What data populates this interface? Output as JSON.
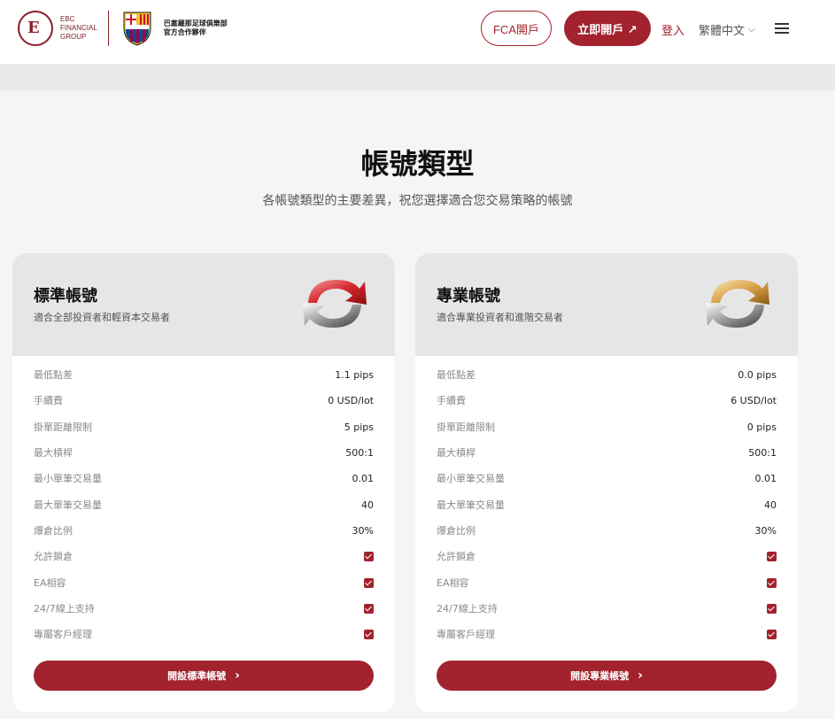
{
  "header": {
    "brand_line1": "EBC",
    "brand_line2": "FINANCIAL",
    "brand_line3": "GROUP",
    "partner_line1": "巴塞羅那足球俱樂部",
    "partner_line2": "官方合作夥伴",
    "fca_label": "FCA開戶",
    "open_label": "立即開戶 ↗",
    "login_label": "登入",
    "language_label": "繁體中文"
  },
  "main": {
    "title": "帳號類型",
    "subtitle": "各帳號類型的主要差異，祝您選擇適合您交易策略的帳號"
  },
  "cards": [
    {
      "title": "標準帳號",
      "desc": "適合全部投資者和輕資本交易者",
      "icon": "refresh-red-icon",
      "rows": [
        {
          "label": "最低點差",
          "value": "1.1 pips"
        },
        {
          "label": "手續費",
          "value": "0 USD/lot"
        },
        {
          "label": "掛單距離限制",
          "value": "5 pips"
        },
        {
          "label": "最大槓桿",
          "value": "500:1"
        },
        {
          "label": "最小單筆交易量",
          "value": "0.01"
        },
        {
          "label": "最大單筆交易量",
          "value": "40"
        },
        {
          "label": "爆倉比例",
          "value": "30%"
        },
        {
          "label": "允許鎖倉",
          "check": true
        },
        {
          "label": "EA相容",
          "check": true
        },
        {
          "label": "24/7線上支持",
          "check": true
        },
        {
          "label": "專屬客戶經理",
          "check": true
        }
      ],
      "button": "開設標準帳號"
    },
    {
      "title": "專業帳號",
      "desc": "適合專業投資者和進階交易者",
      "icon": "refresh-gold-icon",
      "rows": [
        {
          "label": "最低點差",
          "value": "0.0 pips"
        },
        {
          "label": "手續費",
          "value": "6 USD/lot"
        },
        {
          "label": "掛單距離限制",
          "value": "0 pips"
        },
        {
          "label": "最大槓桿",
          "value": "500:1"
        },
        {
          "label": "最小單筆交易量",
          "value": "0.01"
        },
        {
          "label": "最大單筆交易量",
          "value": "40"
        },
        {
          "label": "爆倉比例",
          "value": "30%"
        },
        {
          "label": "允許鎖倉",
          "check": true
        },
        {
          "label": "EA相容",
          "check": true
        },
        {
          "label": "24/7線上支持",
          "check": true
        },
        {
          "label": "專屬客戶經理",
          "check": true
        }
      ],
      "button": "開設專業帳號"
    }
  ],
  "colors": {
    "brand": "#a2222d",
    "card_header": "#e6e6e6",
    "background": "#f5f5f5"
  }
}
